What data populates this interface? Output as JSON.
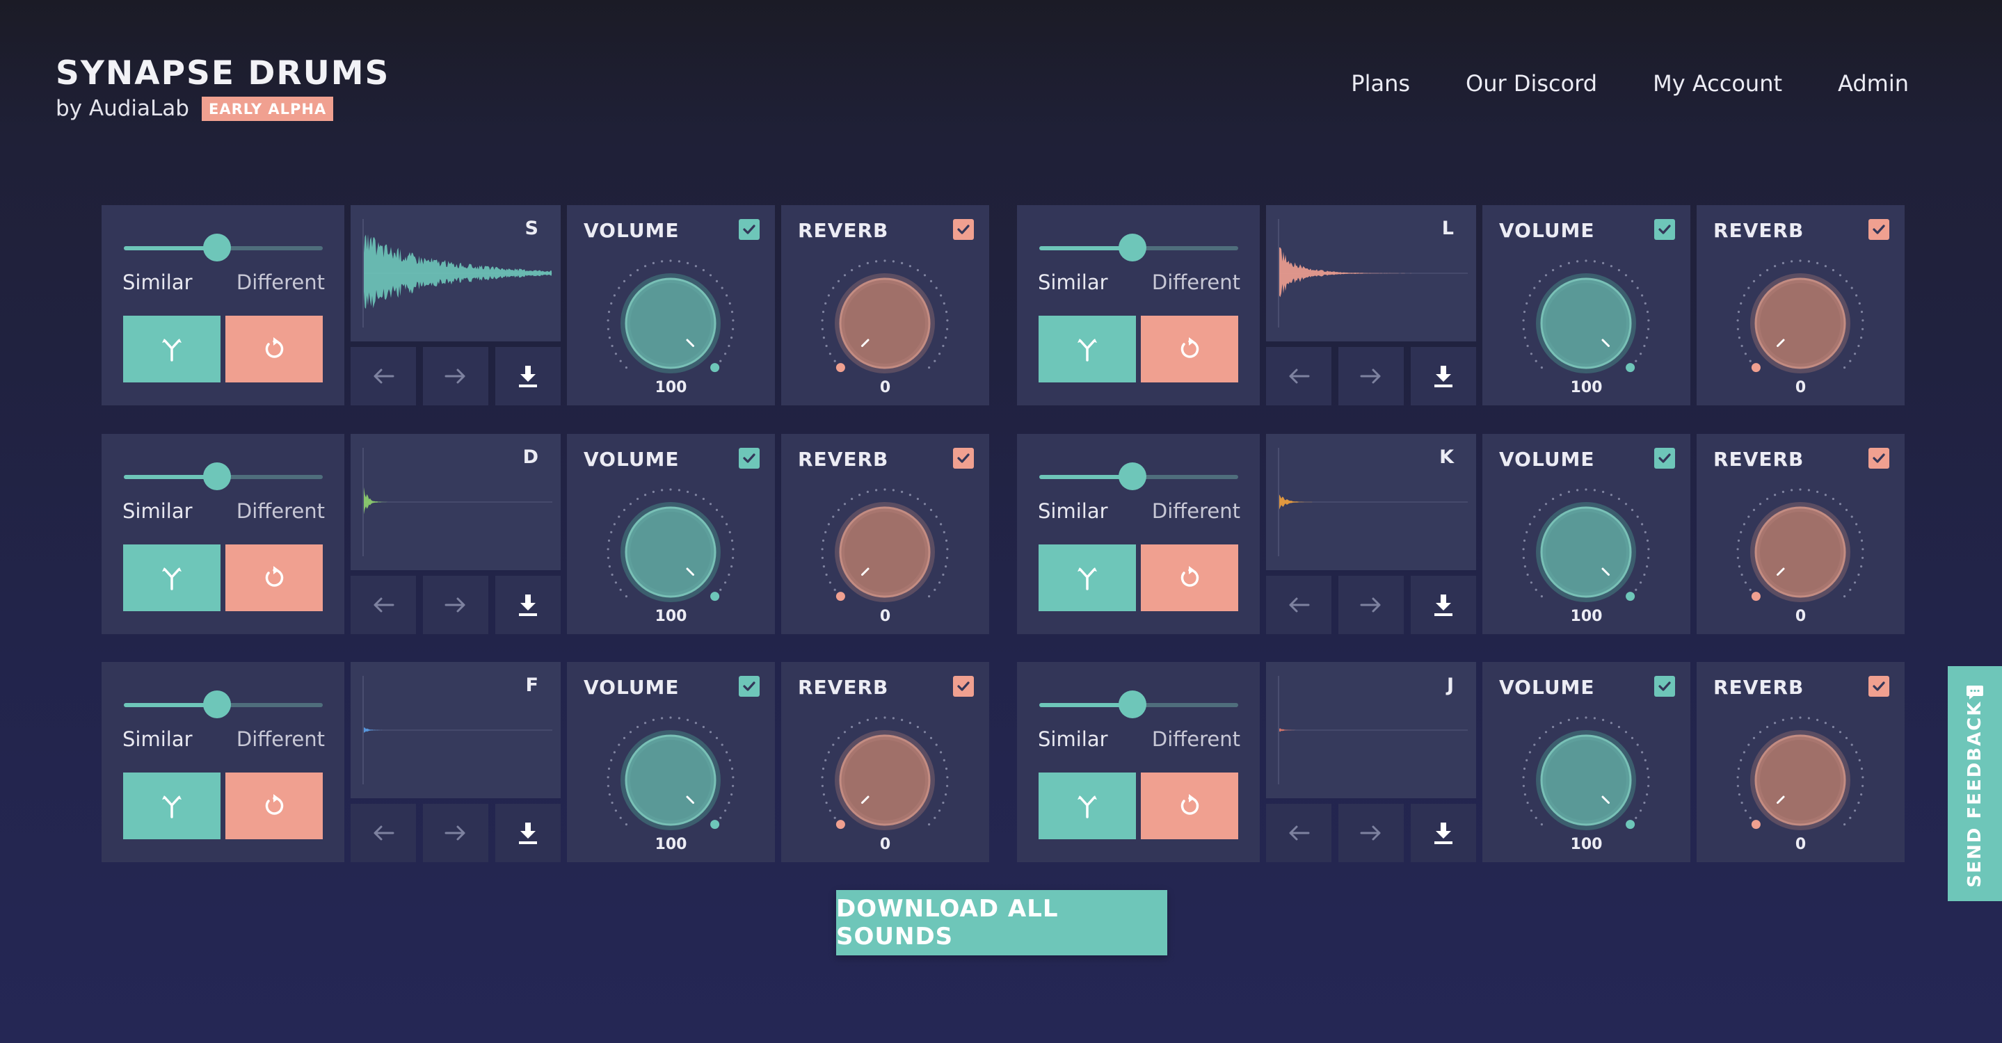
{
  "brand": {
    "title": "SYNAPSE DRUMS",
    "byline": "by AudiaLab",
    "badge": "EARLY ALPHA"
  },
  "nav": [
    {
      "label": "Plans"
    },
    {
      "label": "Our Discord"
    },
    {
      "label": "My Account"
    },
    {
      "label": "Admin"
    }
  ],
  "colors": {
    "accent_teal": "#6ec6b9",
    "accent_salmon": "#f0a090",
    "panel": "#333658",
    "background": "#22244a"
  },
  "labels": {
    "similar": "Similar",
    "different": "Different",
    "volume": "VOLUME",
    "reverb": "REVERB"
  },
  "sounds": [
    {
      "key": "S",
      "similarity": 0.47,
      "wave_color": "#6ec6b9",
      "wave_amp": 0.85,
      "wave_decay": 0.35,
      "volume_enabled": true,
      "volume": "100",
      "reverb_enabled": true,
      "reverb": "0"
    },
    {
      "key": "L",
      "similarity": 0.47,
      "wave_color": "#f0a090",
      "wave_amp": 0.55,
      "wave_decay": 0.1,
      "volume_enabled": true,
      "volume": "100",
      "reverb_enabled": true,
      "reverb": "0"
    },
    {
      "key": "D",
      "similarity": 0.47,
      "wave_color": "#8fd36e",
      "wave_amp": 0.35,
      "wave_decay": 0.02,
      "volume_enabled": true,
      "volume": "100",
      "reverb_enabled": true,
      "reverb": "0"
    },
    {
      "key": "K",
      "similarity": 0.47,
      "wave_color": "#f2a23c",
      "wave_amp": 0.2,
      "wave_decay": 0.03,
      "volume_enabled": true,
      "volume": "100",
      "reverb_enabled": true,
      "reverb": "0"
    },
    {
      "key": "F",
      "similarity": 0.47,
      "wave_color": "#5aa0e8",
      "wave_amp": 0.08,
      "wave_decay": 0.02,
      "volume_enabled": true,
      "volume": "100",
      "reverb_enabled": true,
      "reverb": "0"
    },
    {
      "key": "J",
      "similarity": 0.47,
      "wave_color": "#e07a6a",
      "wave_amp": 0.05,
      "wave_decay": 0.02,
      "volume_enabled": true,
      "volume": "100",
      "reverb_enabled": true,
      "reverb": "0"
    }
  ],
  "download_all": "DOWNLOAD ALL SOUNDS",
  "feedback": "SEND FEEDBACK",
  "icons": {
    "fork": "fork-icon",
    "reset": "reset-icon",
    "prev": "arrow-left-icon",
    "next": "arrow-right-icon",
    "download": "download-icon",
    "check": "checkmark-icon",
    "feedback": "chat-icon"
  }
}
